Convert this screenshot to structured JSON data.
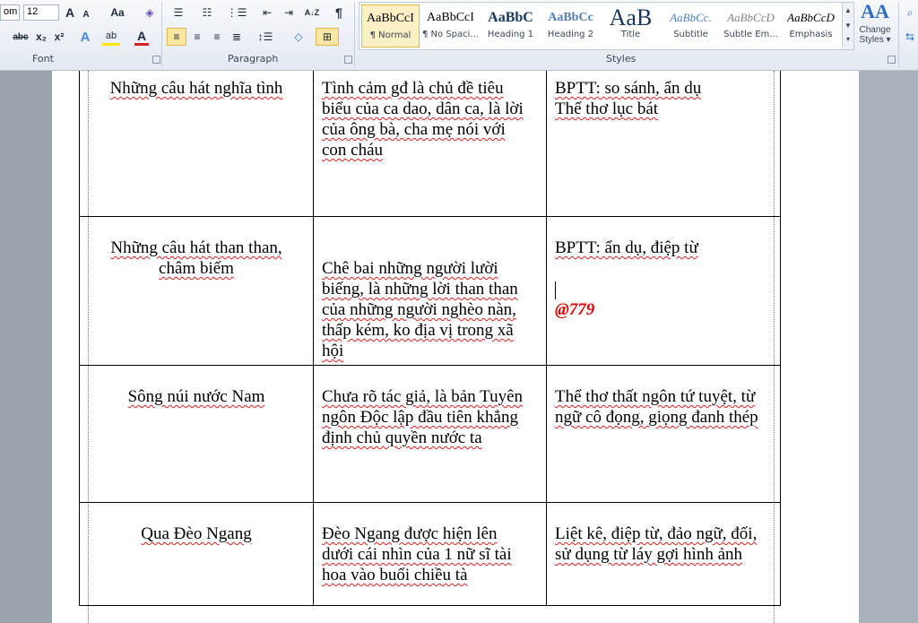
{
  "ribbon": {
    "font": {
      "font_name": "om",
      "font_size": "12",
      "label": "Font"
    },
    "paragraph": {
      "label": "Paragraph"
    },
    "styles": {
      "label": "Styles",
      "items": [
        {
          "sample": "AaBbCcI",
          "name": "¶ Normal"
        },
        {
          "sample": "AaBbCcI",
          "name": "¶ No Spaci..."
        },
        {
          "sample": "AaBbC",
          "name": "Heading 1"
        },
        {
          "sample": "AaBbCc",
          "name": "Heading 2"
        },
        {
          "sample": "AaB",
          "name": "Title"
        },
        {
          "sample": "AaBbCc.",
          "name": "Subtitle"
        },
        {
          "sample": "AaBbCcD",
          "name": "Subtle Em..."
        },
        {
          "sample": "AaBbCcD",
          "name": "Emphasis"
        }
      ],
      "change_styles_line1": "Change",
      "change_styles_line2": "Styles ▾",
      "change_styles_icon": "AA"
    },
    "icons": {
      "grow": "A",
      "shrink": "A",
      "case": "Aa",
      "strike": "abc",
      "sub": "x₂",
      "sup": "x²",
      "effects": "A",
      "highlight": "ab",
      "color": "A",
      "pilcrow": "¶",
      "sort": "A↓Z"
    }
  },
  "table": {
    "rows": [
      {
        "col1": [
          "Những câu hát nghĩa tình"
        ],
        "col2": [
          "Tình cảm gđ là chủ đề tiêu",
          "biểu của ca dao, dân ca, là lời",
          "của ông bà, cha mẹ nói với",
          "con cháu"
        ],
        "col3": [
          "BPTT: so sánh, ẩn dụ",
          "Thể thơ lục bát"
        ]
      },
      {
        "col1": [
          "Những câu hát than than,",
          "châm biếm"
        ],
        "col2": [
          "Chê bai những người lười",
          "biếng, là những lời than than",
          "của những người nghèo nàn,",
          "thấp kém, ko địa vị trong xã",
          "hội"
        ],
        "col3": [
          "BPTT: ẩn dụ, điệp từ"
        ],
        "col3_mark": "@779"
      },
      {
        "col1": [
          "Sông núi nước Nam"
        ],
        "col2": [
          "Chưa rõ tác giả, là bản Tuyên",
          "ngôn Độc lập đầu tiên khẳng",
          "định chủ quyền nước ta"
        ],
        "col3": [
          "Thể thơ thất ngôn tứ tuyệt, từ",
          "ngữ cô đọng, giọng đanh thép"
        ]
      },
      {
        "col1": [
          "Qua Đèo Ngang"
        ],
        "col2": [
          "Đèo Ngang được hiện lên",
          "dưới cái nhìn của 1 nữ sĩ tài",
          "hoa vào buổi chiều tà"
        ],
        "col3": [
          "Liệt kê, điệp từ, đảo ngữ, đối,",
          "sử dụng từ láy gợi hình ảnh"
        ]
      }
    ]
  }
}
